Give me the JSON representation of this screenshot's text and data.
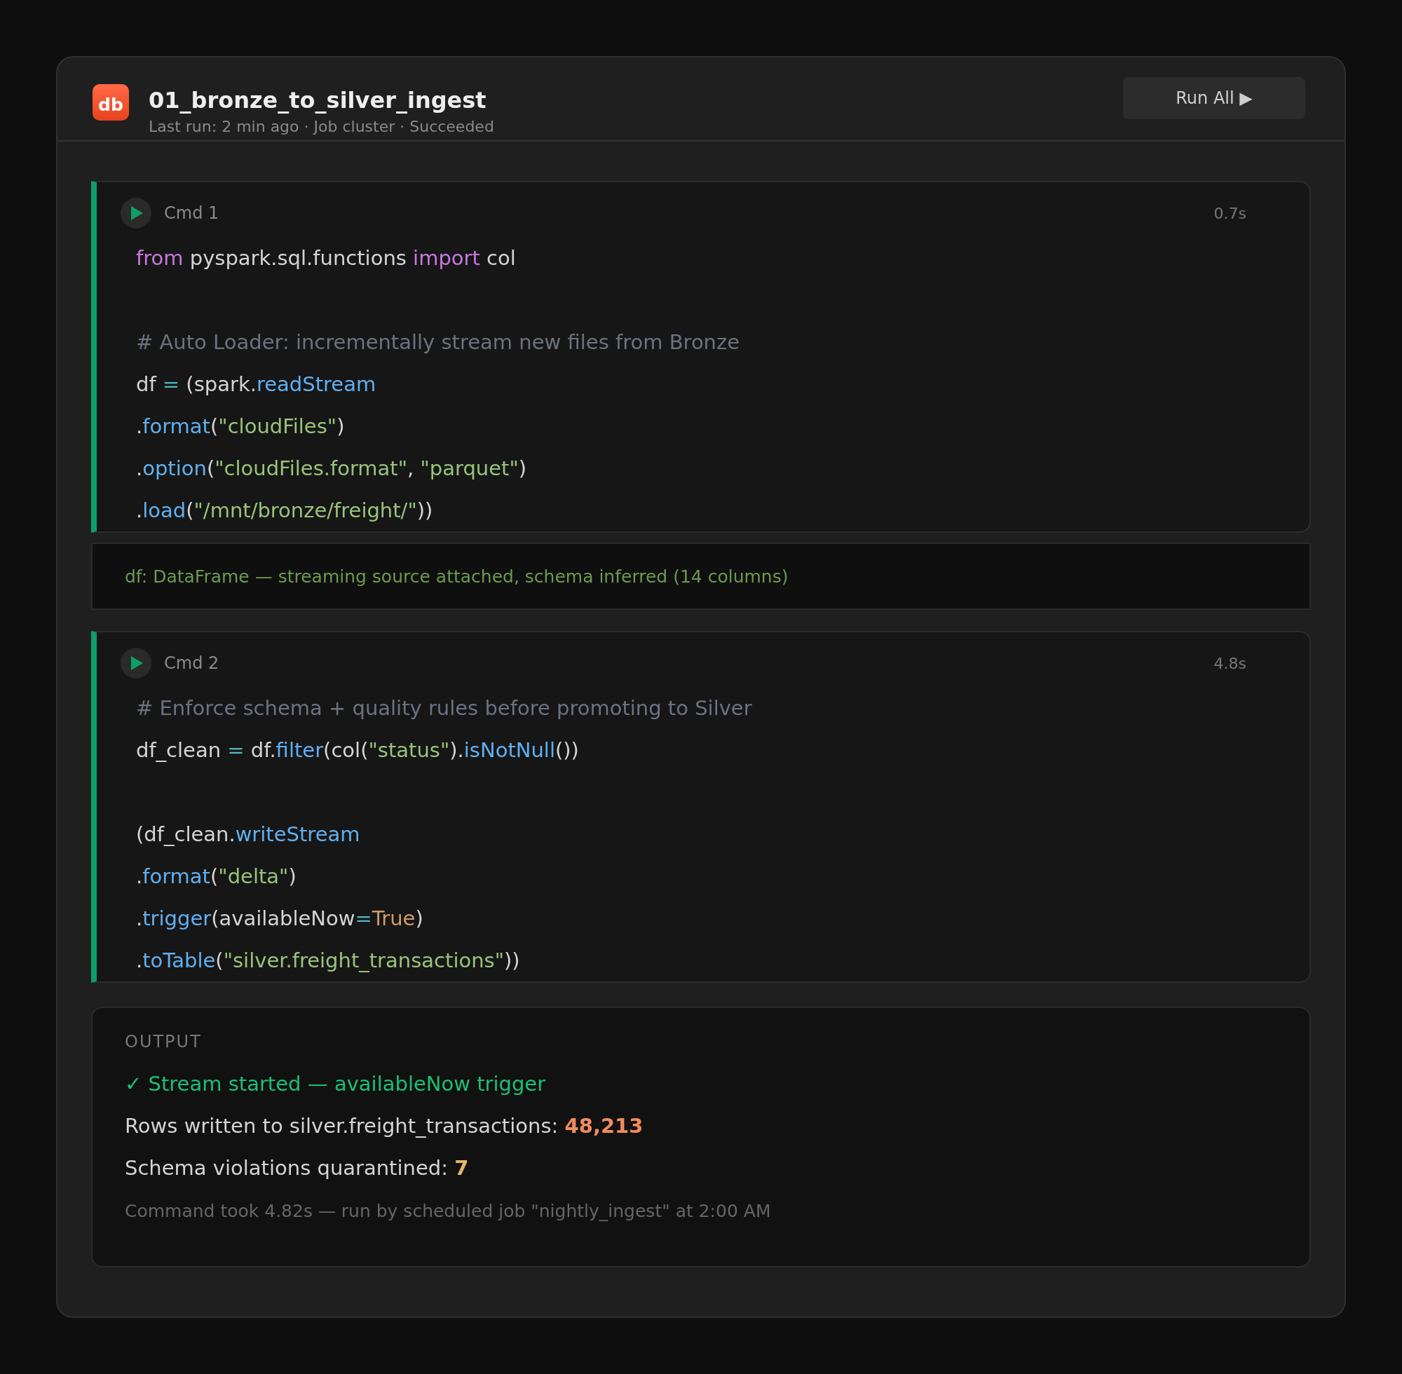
{
  "notebook": {
    "logo": "db",
    "title": "01_bronze_to_silver_ingest",
    "subtitle": "Last run: 2 min ago · Job cluster · Succeeded",
    "run_button": "Run All ▶"
  },
  "cells": [
    {
      "label": "Cmd 1",
      "duration": "0.7s",
      "lines": [
        {
          "kind": "code",
          "tokens": [
            {
              "kind": "kw",
              "text": "from"
            },
            {
              "kind": "plain",
              "text": " pyspark.sql.functions "
            },
            {
              "kind": "kw",
              "text": "import"
            },
            {
              "kind": "plain",
              "text": " col"
            }
          ]
        },
        {
          "kind": "blank"
        },
        {
          "kind": "code",
          "tokens": [
            {
              "kind": "comment",
              "text": "# Auto Loader: incrementally stream new files from Bronze"
            }
          ]
        },
        {
          "kind": "code",
          "tokens": [
            {
              "kind": "plain",
              "text": "df "
            },
            {
              "kind": "op",
              "text": "="
            },
            {
              "kind": "plain",
              "text": " (spark."
            },
            {
              "kind": "fn",
              "text": "readStream"
            }
          ]
        },
        {
          "kind": "code",
          "tokens": [
            {
              "kind": "plain",
              "text": "."
            },
            {
              "kind": "fn",
              "text": "format"
            },
            {
              "kind": "plain",
              "text": "("
            },
            {
              "kind": "str",
              "text": "\"cloudFiles\""
            },
            {
              "kind": "plain",
              "text": ")"
            }
          ]
        },
        {
          "kind": "code",
          "tokens": [
            {
              "kind": "plain",
              "text": "."
            },
            {
              "kind": "fn",
              "text": "option"
            },
            {
              "kind": "plain",
              "text": "("
            },
            {
              "kind": "str",
              "text": "\"cloudFiles.format\""
            },
            {
              "kind": "plain",
              "text": ", "
            },
            {
              "kind": "str",
              "text": "\"parquet\""
            },
            {
              "kind": "plain",
              "text": ")"
            }
          ]
        },
        {
          "kind": "code",
          "tokens": [
            {
              "kind": "plain",
              "text": "."
            },
            {
              "kind": "fn",
              "text": "load"
            },
            {
              "kind": "plain",
              "text": "("
            },
            {
              "kind": "str",
              "text": "\"/mnt/bronze/freight/\""
            },
            {
              "kind": "plain",
              "text": "))"
            }
          ]
        }
      ],
      "result": "df: DataFrame — streaming source attached, schema inferred (14 columns)"
    },
    {
      "label": "Cmd 2",
      "duration": "4.8s",
      "lines": [
        {
          "kind": "code",
          "tokens": [
            {
              "kind": "comment",
              "text": "# Enforce schema + quality rules before promoting to Silver"
            }
          ]
        },
        {
          "kind": "code",
          "tokens": [
            {
              "kind": "plain",
              "text": "df_clean "
            },
            {
              "kind": "op",
              "text": "="
            },
            {
              "kind": "plain",
              "text": " df."
            },
            {
              "kind": "fn",
              "text": "filter"
            },
            {
              "kind": "plain",
              "text": "(col("
            },
            {
              "kind": "str",
              "text": "\"status\""
            },
            {
              "kind": "plain",
              "text": ")."
            },
            {
              "kind": "fn",
              "text": "isNotNull"
            },
            {
              "kind": "plain",
              "text": "())"
            }
          ]
        },
        {
          "kind": "blank"
        },
        {
          "kind": "code",
          "tokens": [
            {
              "kind": "plain",
              "text": "(df_clean."
            },
            {
              "kind": "fn",
              "text": "writeStream"
            }
          ]
        },
        {
          "kind": "code",
          "tokens": [
            {
              "kind": "plain",
              "text": "."
            },
            {
              "kind": "fn",
              "text": "format"
            },
            {
              "kind": "plain",
              "text": "("
            },
            {
              "kind": "str",
              "text": "\"delta\""
            },
            {
              "kind": "plain",
              "text": ")"
            }
          ]
        },
        {
          "kind": "code",
          "tokens": [
            {
              "kind": "plain",
              "text": "."
            },
            {
              "kind": "fn",
              "text": "trigger"
            },
            {
              "kind": "plain",
              "text": "(availableNow"
            },
            {
              "kind": "op",
              "text": "="
            },
            {
              "kind": "const",
              "text": "True"
            },
            {
              "kind": "plain",
              "text": ")"
            }
          ]
        },
        {
          "kind": "code",
          "tokens": [
            {
              "kind": "plain",
              "text": "."
            },
            {
              "kind": "fn",
              "text": "toTable"
            },
            {
              "kind": "plain",
              "text": "("
            },
            {
              "kind": "str",
              "text": "\"silver.freight_transactions\""
            },
            {
              "kind": "plain",
              "text": "))"
            }
          ]
        }
      ]
    }
  ],
  "output": {
    "heading": "OUTPUT",
    "lines": [
      {
        "kind": "success",
        "text": "✓ Stream started — availableNow trigger"
      },
      {
        "kind": "stat",
        "label": "Rows written to silver.freight_transactions:",
        "value": "48,213",
        "color": "#f28b5c"
      },
      {
        "kind": "stat",
        "label": "Schema violations quarantined:",
        "value": "7",
        "color": "#e5b567"
      },
      {
        "kind": "meta",
        "text": "Command took 4.82s — run by scheduled job \"nightly_ingest\" at 2:00 AM"
      }
    ]
  }
}
